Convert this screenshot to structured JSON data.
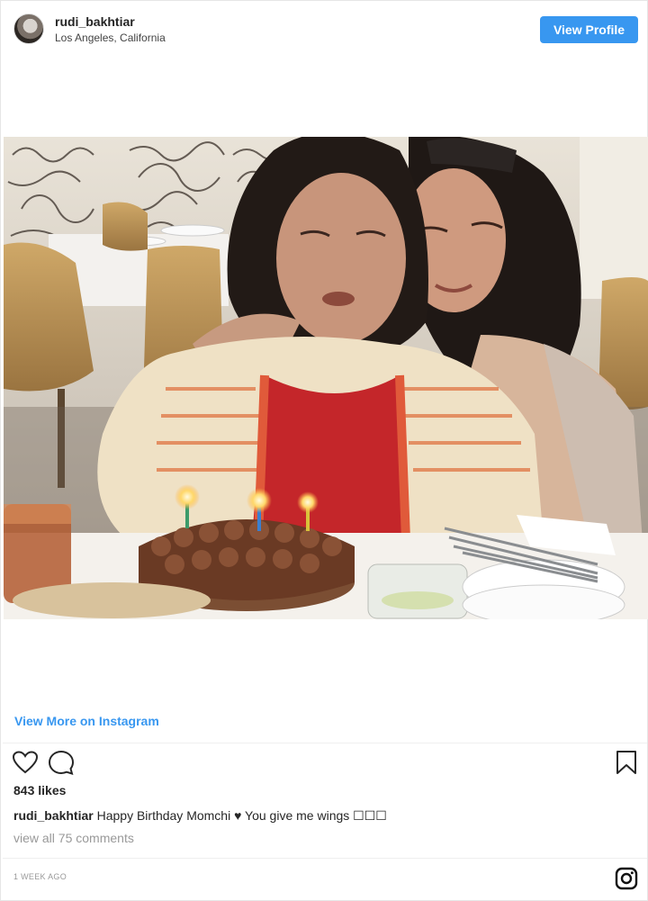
{
  "header": {
    "username": "rudi_bakhtiar",
    "location": "Los Angeles, California",
    "view_profile_label": "View Profile"
  },
  "colors": {
    "accent": "#3897f0",
    "text": "#262626",
    "muted": "#999999"
  },
  "view_more_label": "View More on Instagram",
  "actions": {
    "like_icon": "heart-icon",
    "comment_icon": "comment-icon",
    "save_icon": "bookmark-icon"
  },
  "likes_text": "843 likes",
  "caption": {
    "user": "rudi_bakhtiar",
    "text": "Happy Birthday Momchi ♥ You give me wings ☐☐☐"
  },
  "comments_link": "view all 75 comments",
  "timestamp": "1 WEEK AGO",
  "footer_icon": "instagram-icon"
}
